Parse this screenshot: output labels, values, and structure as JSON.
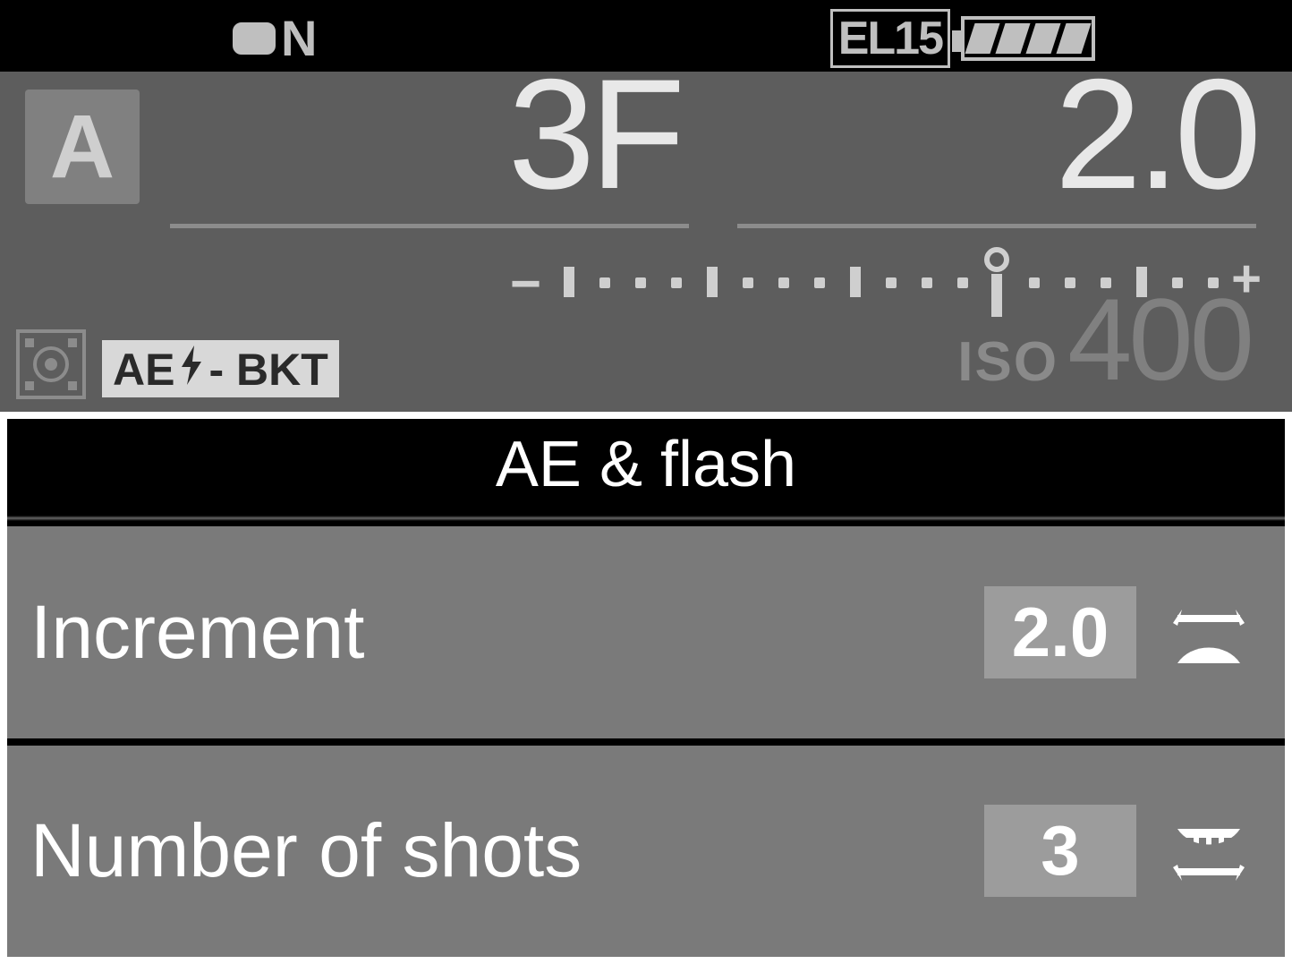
{
  "status": {
    "release_mode": "N",
    "battery_model": "EL15",
    "battery_segments": 4
  },
  "info": {
    "mode": "A",
    "frames_display": "3F",
    "increment_display": "2.0",
    "iso_label": "ISO",
    "iso_value": "400",
    "bracket_badge": "AE  - BKT",
    "exposure_scale": {
      "minus": "−",
      "plus": "+",
      "zero_offset_stops": 1
    }
  },
  "menu": {
    "title": "AE & flash",
    "rows": [
      {
        "label": "Increment",
        "value": "2.0",
        "dial": "main"
      },
      {
        "label": "Number of shots",
        "value": "3",
        "dial": "sub"
      }
    ]
  }
}
